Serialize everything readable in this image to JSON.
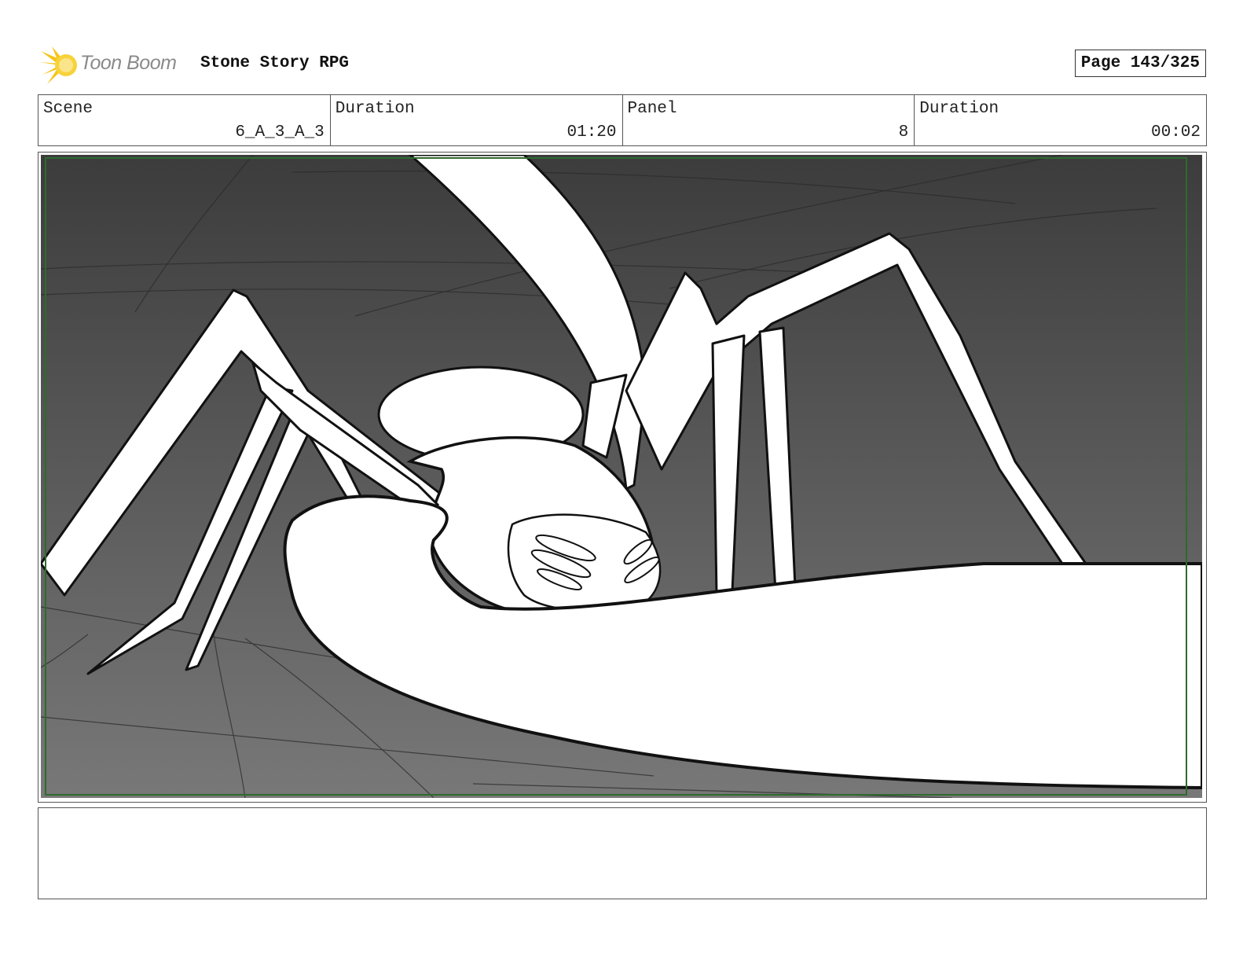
{
  "header": {
    "logo_text": "Toon Boom",
    "project_title": "Stone Story RPG",
    "page_label": "Page 143/325"
  },
  "info": {
    "scene_label": "Scene",
    "scene_value": "6_A_3_A_3",
    "sequence_duration_label": "Duration",
    "sequence_duration_value": "01:20",
    "panel_label": "Panel",
    "panel_value": "8",
    "panel_duration_label": "Duration",
    "panel_duration_value": "00:02"
  },
  "panel_image": {
    "description_icon": "storyboard-sketch-spider-creature",
    "background_top": "#3c3c3c",
    "background_bottom": "#787878",
    "frame_color": "#2e6b2e"
  },
  "notes": {
    "text": ""
  }
}
